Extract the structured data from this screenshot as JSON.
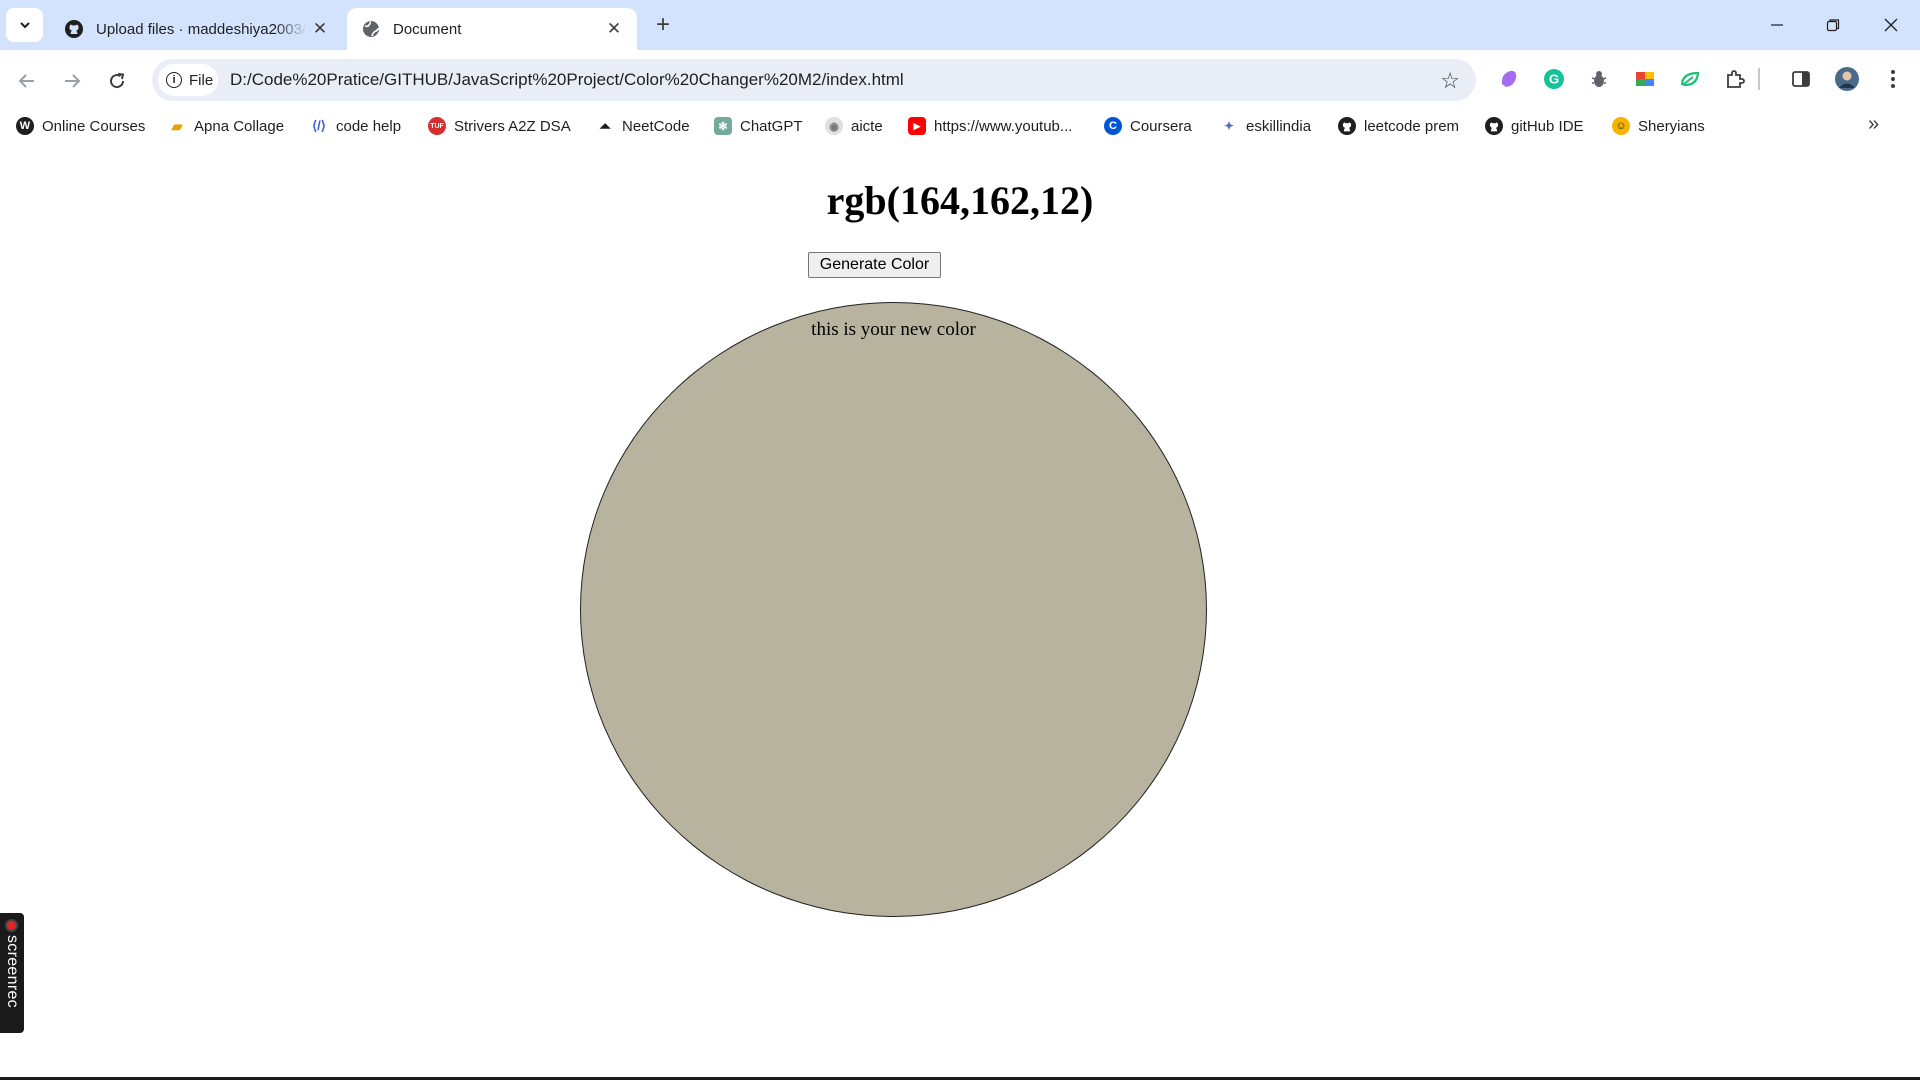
{
  "browser": {
    "tabs": [
      {
        "title": "Upload files · maddeshiya2003/",
        "favicon": "github-icon",
        "active": false
      },
      {
        "title": "Document",
        "favicon": "globe-icon",
        "active": true
      }
    ],
    "address": {
      "chip_label": "File",
      "url": "D:/Code%20Pratice/GITHUB/JavaScript%20Project/Color%20Changer%20M2/index.html"
    },
    "bookmarks": [
      {
        "label": "Online Courses",
        "icon": "wordpress-icon",
        "color": "#1f1f1f"
      },
      {
        "label": "Apna Collage",
        "icon": "apna-college-icon",
        "color": "#e5a100"
      },
      {
        "label": "code help",
        "icon": "code-help-icon",
        "color": "#3b5bdb"
      },
      {
        "label": "Strivers A2Z DSA",
        "icon": "tuf-icon",
        "color": "#d32f2f"
      },
      {
        "label": "NeetCode",
        "icon": "rocket-icon",
        "color": "#1f1f1f"
      },
      {
        "label": "ChatGPT",
        "icon": "chatgpt-icon",
        "color": "#74aa9c"
      },
      {
        "label": "aicte",
        "icon": "aicte-icon",
        "color": "#9e9e9e"
      },
      {
        "label": "https://www.youtub...",
        "icon": "youtube-icon",
        "color": "#ff0000"
      },
      {
        "label": "Coursera",
        "icon": "coursera-icon",
        "color": "#0056d2"
      },
      {
        "label": "eskillindia",
        "icon": "eskillindia-icon",
        "color": "#5c6bc0"
      },
      {
        "label": "leetcode prem",
        "icon": "github-icon",
        "color": "#1f1f1f"
      },
      {
        "label": "gitHub IDE",
        "icon": "github-icon",
        "color": "#1f1f1f"
      },
      {
        "label": "Sheryians",
        "icon": "sheryians-icon",
        "color": "#f4b400"
      }
    ]
  },
  "page": {
    "heading": "rgb(164,162,12)",
    "button_label": "Generate Color",
    "circle_text": "this is your new color",
    "circle_color": "#b8b39f"
  },
  "overlay": {
    "screenrec_label": "screenrec"
  }
}
